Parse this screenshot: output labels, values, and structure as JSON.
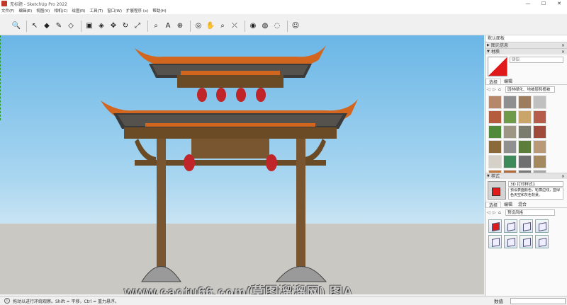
{
  "titlebar": {
    "title": "无标题 - SketchUp Pro 2022",
    "min": "—",
    "max": "☐",
    "close": "✕"
  },
  "menu": [
    "文件(F)",
    "编辑(E)",
    "视图(V)",
    "相机(C)",
    "绘图(R)",
    "工具(T)",
    "窗口(W)",
    "扩展程序 (x)",
    "帮助(H)"
  ],
  "toolbar": {
    "tools": [
      {
        "name": "search-icon",
        "glyph": "🔍"
      },
      {
        "name": "select-icon",
        "glyph": "↖"
      },
      {
        "name": "eraser-icon",
        "glyph": "◆"
      },
      {
        "name": "pencil-icon",
        "glyph": "✎"
      },
      {
        "name": "shape-icon",
        "glyph": "◇"
      },
      {
        "name": "pushpull-icon",
        "glyph": "▣"
      },
      {
        "name": "paint-bucket-icon",
        "glyph": "◈"
      },
      {
        "name": "move-icon",
        "glyph": "✥"
      },
      {
        "name": "rotate-icon",
        "glyph": "↻"
      },
      {
        "name": "scale-icon",
        "glyph": "⤢"
      },
      {
        "name": "tape-measure-icon",
        "glyph": "⌕"
      },
      {
        "name": "text-icon",
        "glyph": "A"
      },
      {
        "name": "dimension-icon",
        "glyph": "⊕"
      },
      {
        "name": "orbit-icon",
        "glyph": "◎"
      },
      {
        "name": "pan-icon",
        "glyph": "✋"
      },
      {
        "name": "zoom-icon",
        "glyph": "⌕"
      },
      {
        "name": "zoom-extents-icon",
        "glyph": "⤫"
      },
      {
        "name": "warehouse-icon",
        "glyph": "◉"
      },
      {
        "name": "extension-icon",
        "glyph": "◍"
      },
      {
        "name": "layout-icon",
        "glyph": "◌"
      },
      {
        "name": "account-icon",
        "glyph": "☺"
      }
    ]
  },
  "viewport": {
    "watermark": "www.caotu66.com(草图溜溜网) 图A"
  },
  "statusbar": {
    "hint": "拖动以进行环绕观察。Shift = 平移，Ctrl = 重力悬浮。",
    "measure_label": "数值",
    "measure_value": ""
  },
  "tray": {
    "title": "默认面板",
    "entity_info": "图元信息",
    "materials": "材质",
    "material_name": "铸铝",
    "tab_select": "选择",
    "tab_edit": "编辑",
    "tab_mix": "混合",
    "library": "园林绿化、地被层和植被",
    "styles": "样式",
    "style_name": "3D 打印样式1",
    "style_desc": "预设表面颜色，轮廓边线，蓝绿色天空和灰色背景。",
    "style_library": "预设风格"
  },
  "colors": {
    "accent": "#e01a1a",
    "sky": "#6ab6e6",
    "ground": "#cac8c2"
  },
  "textures": [
    "#b5886b",
    "#8f8f8f",
    "#9c7d5f",
    "#c0c0c0",
    "#b45c3e",
    "#6e9b4a",
    "#c9a56a",
    "#b55c4a",
    "#4f8a3b",
    "#9e9684",
    "#7b7b6e",
    "#a04a3c",
    "#8a6a3a",
    "#909090",
    "#5d7d3b",
    "#b89a78",
    "#d5d0c8",
    "#3e8a5a",
    "#707070",
    "#a58a60",
    "#c27a3e",
    "#b06a3a",
    "#787878",
    "#a8a8a8"
  ],
  "style_thumbs": 8
}
